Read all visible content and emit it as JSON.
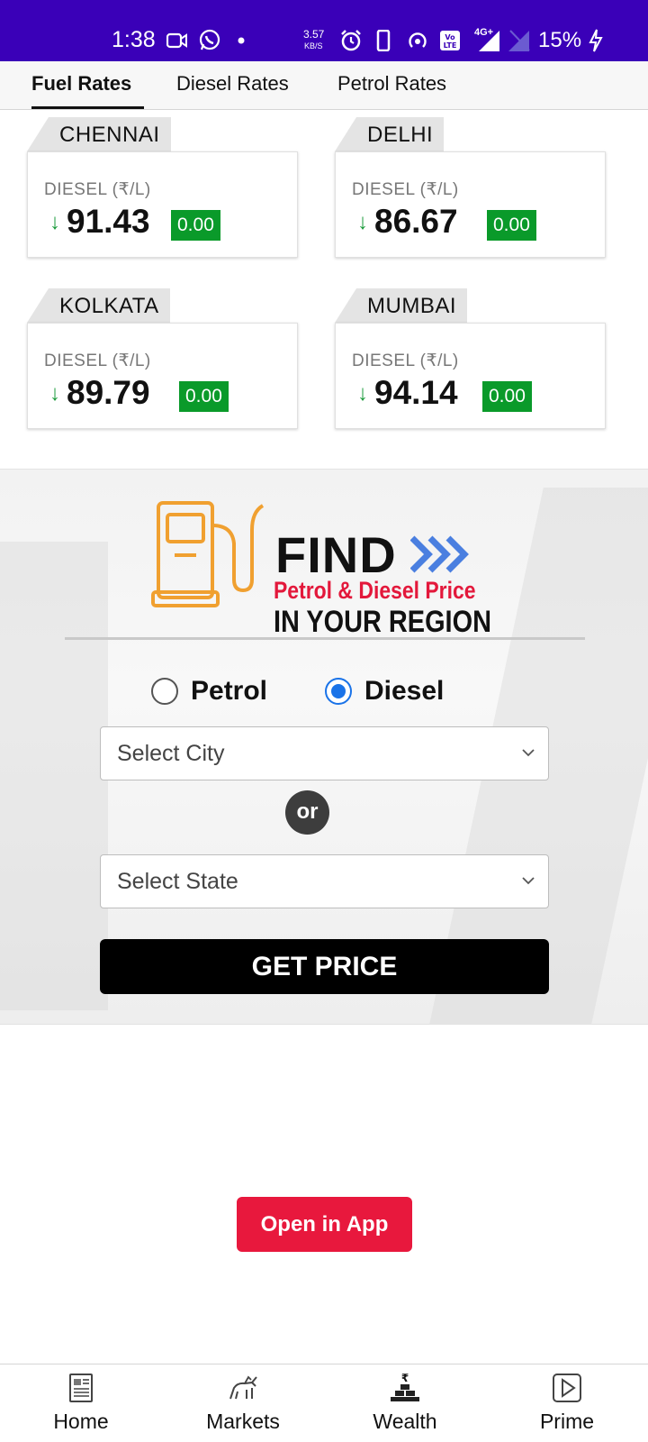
{
  "status_bar": {
    "time": "1:38",
    "net_speed_value": "3.57",
    "net_speed_unit": "KB/S",
    "network": "4G+",
    "volte": "VoLTE",
    "battery": "15%"
  },
  "tabs": [
    {
      "label": "Fuel Rates",
      "active": true
    },
    {
      "label": "Diesel Rates",
      "active": false
    },
    {
      "label": "Petrol Rates",
      "active": false
    }
  ],
  "cities": [
    {
      "name": "CHENNAI",
      "label": "DIESEL (₹/L)",
      "arrow": "↓",
      "price": "91.43",
      "change": "0.00"
    },
    {
      "name": "DELHI",
      "label": "DIESEL (₹/L)",
      "arrow": "↓",
      "price": "86.67",
      "change": "0.00"
    },
    {
      "name": "KOLKATA",
      "label": "DIESEL (₹/L)",
      "arrow": "↓",
      "price": "89.79",
      "change": "0.00"
    },
    {
      "name": "MUMBAI",
      "label": "DIESEL (₹/L)",
      "arrow": "↓",
      "price": "94.14",
      "change": "0.00"
    }
  ],
  "find": {
    "title": "FIND",
    "subtitle1": "Petrol & Diesel Price",
    "subtitle2": "IN YOUR REGION",
    "radio_petrol": "Petrol",
    "radio_diesel": "Diesel",
    "selected_fuel": "Diesel",
    "select_city_placeholder": "Select City",
    "or_label": "or",
    "select_state_placeholder": "Select State",
    "button_label": "GET PRICE"
  },
  "open_app_label": "Open in App",
  "bottom_nav": [
    {
      "label": "Home",
      "icon": "newspaper-icon"
    },
    {
      "label": "Markets",
      "icon": "bull-icon"
    },
    {
      "label": "Wealth",
      "icon": "rupee-gold-icon"
    },
    {
      "label": "Prime",
      "icon": "play-icon"
    }
  ],
  "colors": {
    "status_bar": "#3a00b8",
    "change_badge": "#0a9a2a",
    "price_down_arrow": "#1b9b3b",
    "find_subtitle": "#e3183b",
    "radio_selected": "#1a73e8",
    "open_app": "#e8183d",
    "pump_icon": "#f0a030",
    "chevrons": "#4a7fe0"
  }
}
